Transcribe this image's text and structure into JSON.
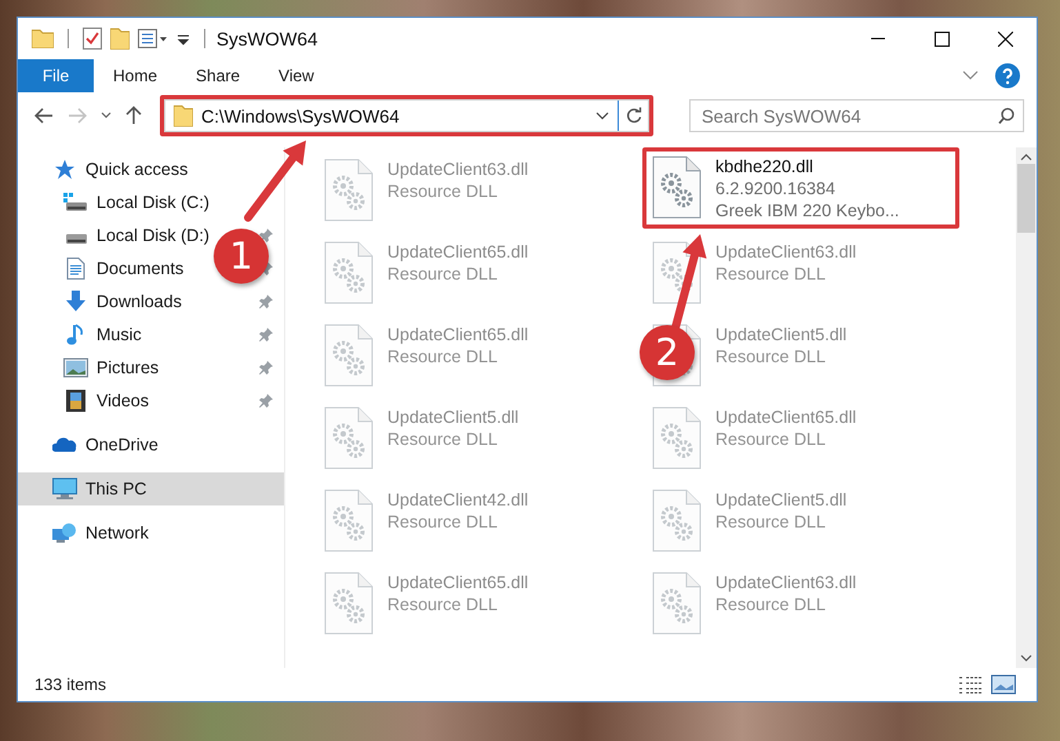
{
  "window": {
    "title": "SysWOW64"
  },
  "ribbon": {
    "tabs": [
      {
        "label": "File",
        "selected": true
      },
      {
        "label": "Home",
        "selected": false
      },
      {
        "label": "Share",
        "selected": false
      },
      {
        "label": "View",
        "selected": false
      }
    ]
  },
  "address_bar": {
    "path": "C:\\Windows\\SysWOW64",
    "annotated": true
  },
  "search": {
    "placeholder": "Search SysWOW64"
  },
  "navigation": [
    {
      "label": "Quick access",
      "kind": "star",
      "pinned": false,
      "selected": false,
      "children": [
        {
          "label": "Local Disk (C:)",
          "kind": "system-drive",
          "pinned": false,
          "selected": false
        },
        {
          "label": "Local Disk (D:)",
          "kind": "drive",
          "pinned": true,
          "selected": false
        },
        {
          "label": "Documents",
          "kind": "documents",
          "pinned": true,
          "selected": false
        },
        {
          "label": "Downloads",
          "kind": "downloads",
          "pinned": true,
          "selected": false
        },
        {
          "label": "Music",
          "kind": "music",
          "pinned": true,
          "selected": false
        },
        {
          "label": "Pictures",
          "kind": "pictures",
          "pinned": true,
          "selected": false
        },
        {
          "label": "Videos",
          "kind": "videos",
          "pinned": true,
          "selected": false
        }
      ]
    },
    {
      "label": "OneDrive",
      "kind": "cloud",
      "pinned": false,
      "selected": false
    },
    {
      "label": "This PC",
      "kind": "pc",
      "pinned": false,
      "selected": true
    },
    {
      "label": "Network",
      "kind": "network",
      "pinned": false,
      "selected": false
    }
  ],
  "files": [
    {
      "name": "UpdateClient63.dll",
      "lines": [
        "Resource DLL"
      ],
      "faded": true,
      "annotated": false
    },
    {
      "name": "kbdhe220.dll",
      "lines": [
        "6.2.9200.16384",
        "Greek IBM 220 Keybo..."
      ],
      "faded": false,
      "annotated": true
    },
    {
      "name": "UpdateClient65.dll",
      "lines": [
        "Resource DLL"
      ],
      "faded": true,
      "annotated": false
    },
    {
      "name": "UpdateClient63.dll",
      "lines": [
        "Resource DLL"
      ],
      "faded": true,
      "annotated": false
    },
    {
      "name": "UpdateClient65.dll",
      "lines": [
        "Resource DLL"
      ],
      "faded": true,
      "annotated": false
    },
    {
      "name": "UpdateClient5.dll",
      "lines": [
        "Resource DLL"
      ],
      "faded": true,
      "annotated": false
    },
    {
      "name": "UpdateClient5.dll",
      "lines": [
        "Resource DLL"
      ],
      "faded": true,
      "annotated": false
    },
    {
      "name": "UpdateClient65.dll",
      "lines": [
        "Resource DLL"
      ],
      "faded": true,
      "annotated": false
    },
    {
      "name": "UpdateClient42.dll",
      "lines": [
        "Resource DLL"
      ],
      "faded": true,
      "annotated": false
    },
    {
      "name": "UpdateClient5.dll",
      "lines": [
        "Resource DLL"
      ],
      "faded": true,
      "annotated": false
    },
    {
      "name": "UpdateClient65.dll",
      "lines": [
        "Resource DLL"
      ],
      "faded": true,
      "annotated": false
    },
    {
      "name": "UpdateClient63.dll",
      "lines": [
        "Resource DLL"
      ],
      "faded": true,
      "annotated": false
    }
  ],
  "status_bar": {
    "item_count": "133 items"
  },
  "annotations": [
    {
      "number": "1"
    },
    {
      "number": "2"
    }
  ]
}
